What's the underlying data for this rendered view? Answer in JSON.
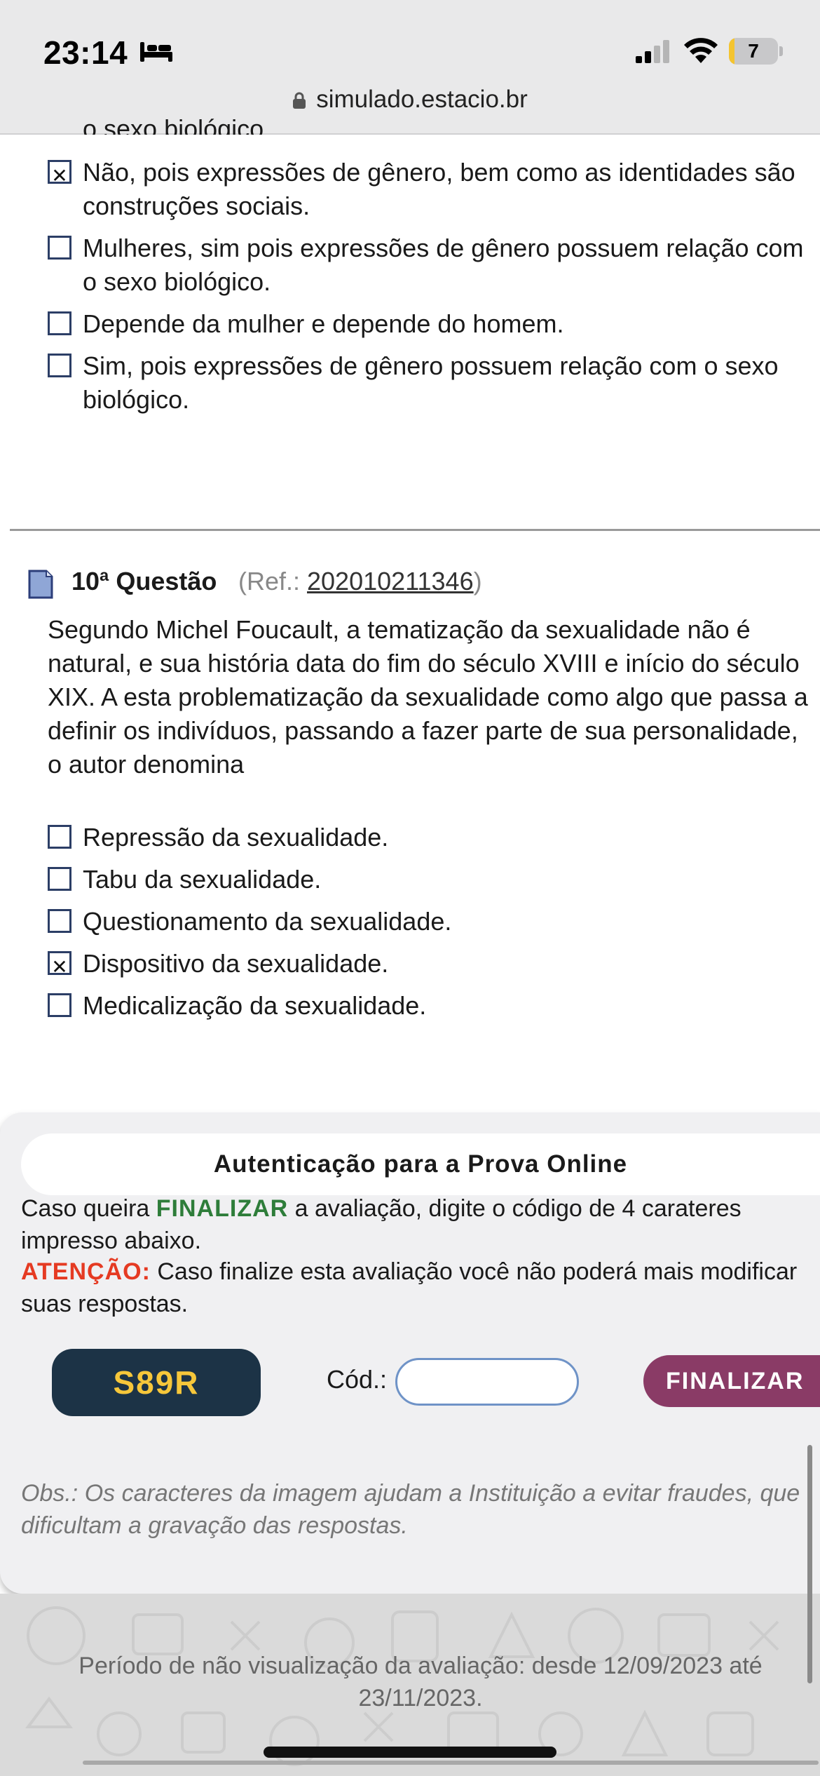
{
  "status_bar": {
    "time": "23:14",
    "battery_percent": "7",
    "battery_level": 0.07,
    "colors": {
      "battery_fill": "#f4c430"
    }
  },
  "url_bar": {
    "domain": "simulado.estacio.br"
  },
  "prev_question": {
    "clipped_text": "o sexo biológico.",
    "options": [
      {
        "checked": true,
        "lines": [
          "Não, pois expressões de gênero, bem como as identidades são",
          "construções sociais."
        ]
      },
      {
        "checked": false,
        "lines": [
          "Mulheres, sim pois expressões de gênero possuem relação com",
          "o sexo biológico."
        ]
      },
      {
        "checked": false,
        "lines": [
          "Depende da mulher e depende do homem."
        ]
      },
      {
        "checked": false,
        "lines": [
          "Sim, pois expressões de gênero possuem relação com o sexo",
          "biológico."
        ]
      }
    ]
  },
  "question10": {
    "number": "10ª Questão",
    "ref_prefix": "(Ref.: ",
    "ref_code": "202010211346",
    "ref_suffix": ")",
    "body_lines": [
      "Segundo Michel Foucault, a tematização da sexualidade não é",
      "natural, e sua história data do fim do século XVIII e início do século",
      "XIX. A esta problematização da sexualidade como algo que passa a",
      "definir os indivíduos, passando a fazer parte de sua personalidade,",
      "o autor denomina"
    ],
    "options": [
      {
        "checked": false,
        "label": "Repressão da sexualidade."
      },
      {
        "checked": false,
        "label": "Tabu da sexualidade."
      },
      {
        "checked": false,
        "label": "Questionamento da sexualidade."
      },
      {
        "checked": true,
        "label": "Dispositivo da sexualidade."
      },
      {
        "checked": false,
        "label": "Medicalização da sexualidade."
      }
    ]
  },
  "auth": {
    "title": "Autenticação para a Prova Online",
    "line1_pre": "Caso queira ",
    "line1_kw": "FINALIZAR",
    "line1_post": " a avaliação, digite o código de 4 carateres",
    "line2": "impresso abaixo.",
    "line3_kw": "ATENÇÃO:",
    "line3_post": " Caso finalize esta avaliação você não poderá mais modificar",
    "line4": "suas respostas.",
    "captcha_code": "S89R",
    "code_label": "Cód.:",
    "code_value": "",
    "finalize_label": "FINALIZAR",
    "obs_line1": "Obs.: Os caracteres da imagem ajudam a Instituição a evitar fraudes, que",
    "obs_line2": "dificultam a gravação das respostas.",
    "colors": {
      "finalize_button": "#8a3b66",
      "captcha_bg": "#1c3346",
      "captcha_text": "#f6c73a",
      "keyword_green": "#2e7d3a",
      "keyword_red": "#e53a22"
    }
  },
  "footer": {
    "line1": "Período de não visualização da avaliação: desde 12/09/2023 até",
    "line2": "23/11/2023."
  }
}
